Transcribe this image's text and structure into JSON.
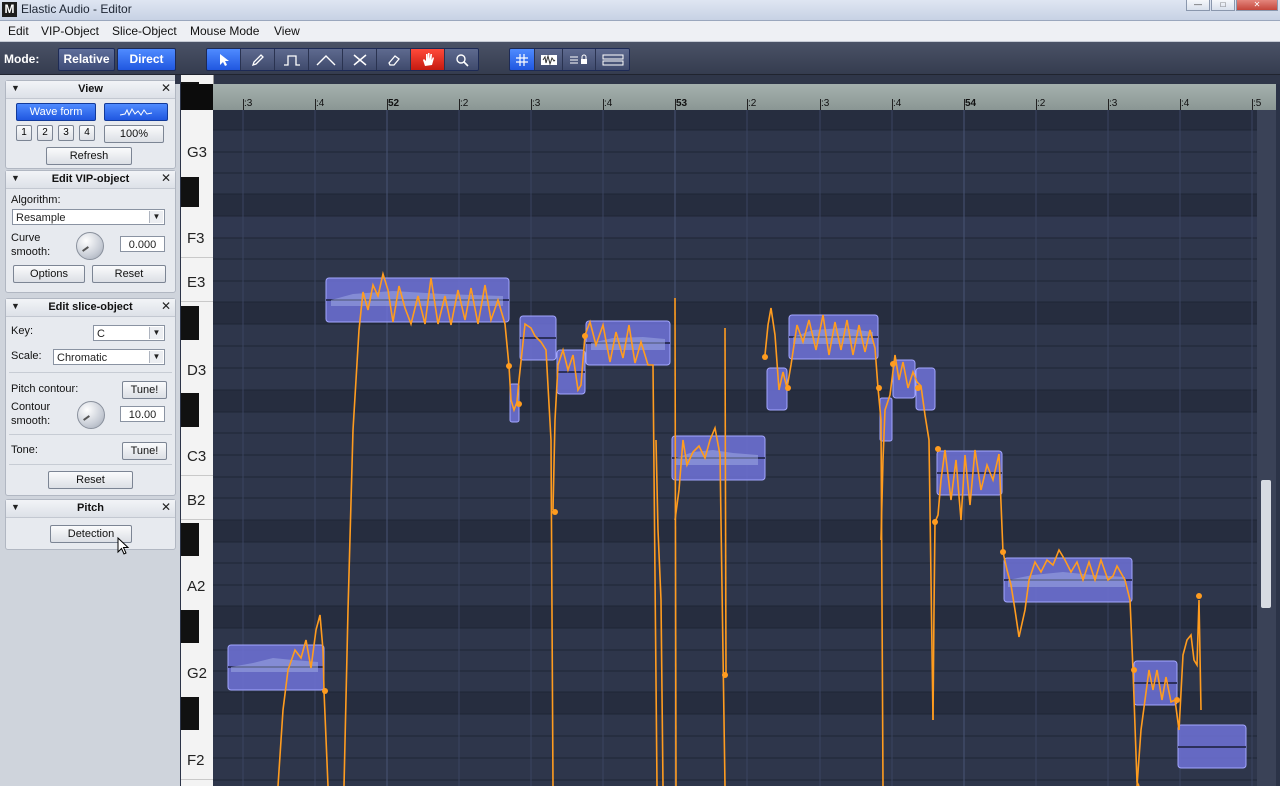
{
  "window": {
    "title": "Elastic Audio - Editor",
    "logo": "M",
    "minimize": "—",
    "maximize": "□",
    "close": "✕"
  },
  "menu": [
    "Edit",
    "VIP-Object",
    "Slice-Object",
    "Mouse Mode",
    "View"
  ],
  "toolbar": {
    "mode_label": "Mode:",
    "relative": "Relative",
    "direct": "Direct",
    "tools": [
      "arrow-pointer-icon",
      "pencil-icon",
      "step-curve-icon",
      "peak-curve-icon",
      "scissors-icon",
      "eraser-icon",
      "hand-icon",
      "magnifier-icon"
    ],
    "view_tools": [
      "grid-icon",
      "waveform-view-icon",
      "lock-lines-icon",
      "lanes-icon"
    ]
  },
  "view_panel": {
    "title": "View",
    "waveform": "Wave form",
    "zoom_buttons": [
      "1",
      "2",
      "3",
      "4"
    ],
    "zoom_percent": "100%",
    "refresh": "Refresh"
  },
  "vip_panel": {
    "title": "Edit VIP-object",
    "algorithm_label": "Algorithm:",
    "algorithm_value": "Resample",
    "curve_label": "Curve",
    "smooth_label": "smooth:",
    "curve_value": "0.000",
    "options": "Options",
    "reset": "Reset"
  },
  "slice_panel": {
    "title": "Edit slice-object",
    "key_label": "Key:",
    "key_value": "C",
    "scale_label": "Scale:",
    "scale_value": "Chromatic",
    "pitch_contour_label": "Pitch contour:",
    "tune": "Tune!",
    "contour_label": "Contour",
    "smooth_label": "smooth:",
    "contour_value": "10.00",
    "tone_label": "Tone:",
    "tone_tune": "Tune!",
    "reset": "Reset"
  },
  "pitch_panel": {
    "title": "Pitch",
    "detection": "Detection"
  },
  "piano_notes": [
    "G3",
    "F3",
    "E3",
    "D3",
    "C3",
    "B2",
    "A2",
    "G2",
    "F2"
  ],
  "ruler": [
    ":3",
    ":4",
    "52",
    ":2",
    ":3",
    ":4",
    "53",
    ":2",
    ":3",
    ":4",
    "54",
    ":2",
    ":3",
    ":4",
    ":5"
  ],
  "colors": {
    "accent": "#2a63f0",
    "pitch_curve": "#ff9c1f",
    "note_block": "#6f72d8",
    "editor_bg": "#2b3347"
  }
}
